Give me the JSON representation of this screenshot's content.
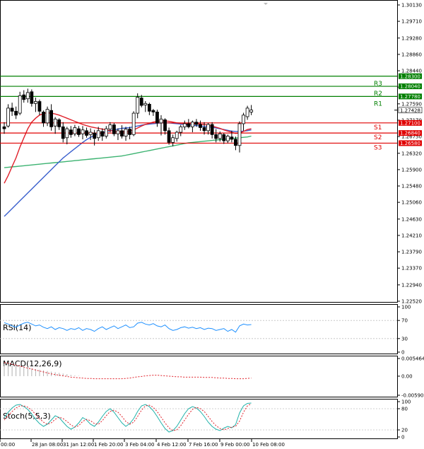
{
  "chart_data": {
    "type": "candlestick",
    "main": {
      "y_ticks": [
        "1.30130",
        "1.29710",
        "1.29280",
        "1.28860",
        "1.28440",
        "1.28020",
        "1.27590",
        "1.27170",
        "1.26750",
        "1.26320",
        "1.25900",
        "1.25480",
        "1.25060",
        "1.24630",
        "1.24210",
        "1.23790",
        "1.23370",
        "1.22940",
        "1.22520"
      ],
      "current_price": "1.27428",
      "levels": [
        {
          "name": "R3",
          "price": "1.28300",
          "color": "#007f00"
        },
        {
          "name": "R2",
          "price": "1.28040",
          "color": "#007f00"
        },
        {
          "name": "R1",
          "price": "1.27780",
          "color": "#007f00"
        },
        {
          "name": "S1",
          "price": "1.27100",
          "color": "#e00000"
        },
        {
          "name": "S2",
          "price": "1.26840",
          "color": "#e00000"
        },
        {
          "name": "S3",
          "price": "1.26580",
          "color": "#e00000"
        }
      ]
    },
    "x_ticks": [
      "00:00",
      "28 Jan 08:00",
      "31 Jan 12:00",
      "1 Feb 20:00",
      "3 Feb 04:00",
      "4 Feb 12:00",
      "7 Feb 16:00",
      "9 Feb 00:00",
      "10 Feb 08:00"
    ],
    "candles": [
      {
        "o": 1.27,
        "h": 1.2712,
        "l": 1.2682,
        "c": 1.2695
      },
      {
        "o": 1.2702,
        "h": 1.2758,
        "l": 1.2698,
        "c": 1.2748
      },
      {
        "o": 1.2748,
        "h": 1.2762,
        "l": 1.2728,
        "c": 1.274
      },
      {
        "o": 1.274,
        "h": 1.2752,
        "l": 1.272,
        "c": 1.273
      },
      {
        "o": 1.2735,
        "h": 1.279,
        "l": 1.273,
        "c": 1.278
      },
      {
        "o": 1.2782,
        "h": 1.2794,
        "l": 1.2762,
        "c": 1.277
      },
      {
        "o": 1.2772,
        "h": 1.2798,
        "l": 1.2762,
        "c": 1.2788
      },
      {
        "o": 1.279,
        "h": 1.2796,
        "l": 1.2752,
        "c": 1.276
      },
      {
        "o": 1.276,
        "h": 1.2775,
        "l": 1.2738,
        "c": 1.2765
      },
      {
        "o": 1.2765,
        "h": 1.277,
        "l": 1.273,
        "c": 1.274
      },
      {
        "o": 1.2738,
        "h": 1.2742,
        "l": 1.27,
        "c": 1.271
      },
      {
        "o": 1.271,
        "h": 1.2752,
        "l": 1.2702,
        "c": 1.2745
      },
      {
        "o": 1.2742,
        "h": 1.2758,
        "l": 1.269,
        "c": 1.27
      },
      {
        "o": 1.2702,
        "h": 1.2725,
        "l": 1.2682,
        "c": 1.272
      },
      {
        "o": 1.2718,
        "h": 1.2722,
        "l": 1.2692,
        "c": 1.27
      },
      {
        "o": 1.27,
        "h": 1.2712,
        "l": 1.266,
        "c": 1.267
      },
      {
        "o": 1.2672,
        "h": 1.27,
        "l": 1.2655,
        "c": 1.2695
      },
      {
        "o": 1.2692,
        "h": 1.2702,
        "l": 1.2672,
        "c": 1.268
      },
      {
        "o": 1.2682,
        "h": 1.2705,
        "l": 1.2676,
        "c": 1.2698
      },
      {
        "o": 1.2695,
        "h": 1.2702,
        "l": 1.2674,
        "c": 1.268
      },
      {
        "o": 1.2682,
        "h": 1.2702,
        "l": 1.2668,
        "c": 1.2692
      },
      {
        "o": 1.269,
        "h": 1.2698,
        "l": 1.2672,
        "c": 1.2678
      },
      {
        "o": 1.268,
        "h": 1.2696,
        "l": 1.2666,
        "c": 1.2686
      },
      {
        "o": 1.2684,
        "h": 1.2692,
        "l": 1.2652,
        "c": 1.267
      },
      {
        "o": 1.2672,
        "h": 1.27,
        "l": 1.2664,
        "c": 1.269
      },
      {
        "o": 1.2688,
        "h": 1.2696,
        "l": 1.2664,
        "c": 1.2676
      },
      {
        "o": 1.2676,
        "h": 1.2702,
        "l": 1.267,
        "c": 1.2695
      },
      {
        "o": 1.2694,
        "h": 1.2712,
        "l": 1.2686,
        "c": 1.2705
      },
      {
        "o": 1.2705,
        "h": 1.271,
        "l": 1.2676,
        "c": 1.2682
      },
      {
        "o": 1.2682,
        "h": 1.2696,
        "l": 1.2666,
        "c": 1.269
      },
      {
        "o": 1.269,
        "h": 1.2704,
        "l": 1.267,
        "c": 1.2676
      },
      {
        "o": 1.2676,
        "h": 1.27,
        "l": 1.2664,
        "c": 1.2694
      },
      {
        "o": 1.2694,
        "h": 1.27,
        "l": 1.2668,
        "c": 1.268
      },
      {
        "o": 1.268,
        "h": 1.274,
        "l": 1.2676,
        "c": 1.2735
      },
      {
        "o": 1.2735,
        "h": 1.2786,
        "l": 1.2722,
        "c": 1.2776
      },
      {
        "o": 1.2774,
        "h": 1.2782,
        "l": 1.275,
        "c": 1.2755
      },
      {
        "o": 1.2756,
        "h": 1.2766,
        "l": 1.2738,
        "c": 1.276
      },
      {
        "o": 1.2758,
        "h": 1.2762,
        "l": 1.273,
        "c": 1.274
      },
      {
        "o": 1.2742,
        "h": 1.2746,
        "l": 1.2728,
        "c": 1.2738
      },
      {
        "o": 1.2738,
        "h": 1.2744,
        "l": 1.27,
        "c": 1.271
      },
      {
        "o": 1.271,
        "h": 1.273,
        "l": 1.2678,
        "c": 1.272
      },
      {
        "o": 1.2718,
        "h": 1.2722,
        "l": 1.268,
        "c": 1.269
      },
      {
        "o": 1.269,
        "h": 1.2698,
        "l": 1.2654,
        "c": 1.266
      },
      {
        "o": 1.266,
        "h": 1.268,
        "l": 1.265,
        "c": 1.2672
      },
      {
        "o": 1.267,
        "h": 1.269,
        "l": 1.2662,
        "c": 1.2686
      },
      {
        "o": 1.2686,
        "h": 1.2705,
        "l": 1.2676,
        "c": 1.27
      },
      {
        "o": 1.27,
        "h": 1.2716,
        "l": 1.2692,
        "c": 1.2708
      },
      {
        "o": 1.2708,
        "h": 1.272,
        "l": 1.2696,
        "c": 1.27
      },
      {
        "o": 1.27,
        "h": 1.2716,
        "l": 1.2686,
        "c": 1.2712
      },
      {
        "o": 1.2712,
        "h": 1.272,
        "l": 1.27,
        "c": 1.2706
      },
      {
        "o": 1.2706,
        "h": 1.2716,
        "l": 1.269,
        "c": 1.2698
      },
      {
        "o": 1.2698,
        "h": 1.2712,
        "l": 1.268,
        "c": 1.269
      },
      {
        "o": 1.269,
        "h": 1.271,
        "l": 1.268,
        "c": 1.2706
      },
      {
        "o": 1.2706,
        "h": 1.2712,
        "l": 1.267,
        "c": 1.268
      },
      {
        "o": 1.268,
        "h": 1.2694,
        "l": 1.266,
        "c": 1.267
      },
      {
        "o": 1.267,
        "h": 1.2688,
        "l": 1.2662,
        "c": 1.2682
      },
      {
        "o": 1.268,
        "h": 1.2684,
        "l": 1.2656,
        "c": 1.2664
      },
      {
        "o": 1.2664,
        "h": 1.268,
        "l": 1.2658,
        "c": 1.2676
      },
      {
        "o": 1.2674,
        "h": 1.269,
        "l": 1.266,
        "c": 1.2668
      },
      {
        "o": 1.2668,
        "h": 1.2675,
        "l": 1.264,
        "c": 1.2652
      },
      {
        "o": 1.2652,
        "h": 1.2714,
        "l": 1.2634,
        "c": 1.2708
      },
      {
        "o": 1.2708,
        "h": 1.2736,
        "l": 1.269,
        "c": 1.273
      },
      {
        "o": 1.2726,
        "h": 1.2754,
        "l": 1.2718,
        "c": 1.2748
      },
      {
        "o": 1.2738,
        "h": 1.2756,
        "l": 1.273,
        "c": 1.2743
      }
    ],
    "ma_fast": [
      1.2555,
      1.2575,
      1.2598,
      1.262,
      1.2648,
      1.2672,
      1.2695,
      1.2712,
      1.2722,
      1.273,
      1.2734,
      1.2736,
      1.2735,
      1.2733,
      1.273,
      1.2726,
      1.2722,
      1.2718,
      1.2714,
      1.271,
      1.2706,
      1.2703,
      1.27,
      1.2698,
      1.2696,
      1.2694,
      1.2692,
      1.269,
      1.2689,
      1.2688,
      1.2688,
      1.2688,
      1.2689,
      1.2692,
      1.2697,
      1.2702,
      1.2706,
      1.2709,
      1.2712,
      1.2714,
      1.2715,
      1.2715,
      1.2714,
      1.2712,
      1.271,
      1.2709,
      1.2708,
      1.2708,
      1.2708,
      1.2708,
      1.2707,
      1.2706,
      1.2704,
      1.2702,
      1.2699,
      1.2696,
      1.2692,
      1.2689,
      1.2686,
      1.2683,
      1.2684,
      1.2688,
      1.2693,
      1.2695
    ],
    "ma_mid": [
      1.247,
      1.248,
      1.249,
      1.25,
      1.251,
      1.252,
      1.253,
      1.254,
      1.255,
      1.256,
      1.257,
      1.258,
      1.259,
      1.26,
      1.261,
      1.262,
      1.2628,
      1.2636,
      1.2644,
      1.2652,
      1.266,
      1.2667,
      1.2673,
      1.2678,
      1.2682,
      1.2685,
      1.2688,
      1.269,
      1.2692,
      1.2694,
      1.2696,
      1.2697,
      1.2698,
      1.27,
      1.2702,
      1.2704,
      1.2706,
      1.2707,
      1.2708,
      1.2709,
      1.271,
      1.271,
      1.271,
      1.2709,
      1.2708,
      1.2707,
      1.2706,
      1.2705,
      1.2704,
      1.2703,
      1.2702,
      1.2701,
      1.27,
      1.2699,
      1.2697,
      1.2695,
      1.2693,
      1.2691,
      1.2689,
      1.2688,
      1.2688,
      1.2689,
      1.269,
      1.2692
    ],
    "ma_slow": [
      1.2595,
      1.2596,
      1.2597,
      1.2598,
      1.2599,
      1.26,
      1.2601,
      1.2602,
      1.2603,
      1.2604,
      1.2605,
      1.2606,
      1.2607,
      1.2608,
      1.2609,
      1.261,
      1.2611,
      1.2612,
      1.2613,
      1.2614,
      1.2615,
      1.2616,
      1.2617,
      1.2618,
      1.2619,
      1.262,
      1.2621,
      1.2622,
      1.2623,
      1.2624,
      1.2625,
      1.2627,
      1.2629,
      1.2631,
      1.2633,
      1.2635,
      1.2637,
      1.2639,
      1.2641,
      1.2643,
      1.2645,
      1.2647,
      1.2649,
      1.2651,
      1.2653,
      1.2655,
      1.2657,
      1.2659,
      1.266,
      1.2661,
      1.2662,
      1.2663,
      1.2664,
      1.2665,
      1.2666,
      1.2667,
      1.2668,
      1.2669,
      1.267,
      1.2671,
      1.2672,
      1.2673,
      1.2674,
      1.2676
    ],
    "rsi": {
      "title": "RSI(14)",
      "ticks": [
        "100",
        "70",
        "30",
        "0"
      ],
      "values": [
        65,
        62,
        58,
        55,
        60,
        64,
        66,
        62,
        58,
        60,
        55,
        52,
        56,
        50,
        54,
        52,
        48,
        52,
        50,
        54,
        48,
        52,
        50,
        46,
        52,
        56,
        50,
        54,
        58,
        52,
        56,
        60,
        54,
        56,
        64,
        66,
        62,
        60,
        63,
        58,
        56,
        60,
        52,
        48,
        50,
        54,
        56,
        53,
        55,
        52,
        54,
        50,
        53,
        52,
        48,
        50,
        52,
        46,
        50,
        44,
        58,
        62,
        60,
        61
      ]
    },
    "macd": {
      "title": "MACD(12,26,9)",
      "ticks": [
        "0.005464",
        "0.00",
        "-0.005908"
      ],
      "hist": [
        0.0038,
        0.0036,
        0.0034,
        0.0032,
        0.003,
        0.0028,
        0.0026,
        0.0024,
        0.0022,
        0.002,
        0.0018,
        0.0016,
        0.0014,
        0.0012,
        0.001,
        0.0008,
        0.0006,
        0.0004,
        0.0002,
        0.0001,
        0,
        0,
        0,
        0,
        0,
        0,
        0,
        0,
        0,
        0,
        0,
        0,
        0,
        0,
        0,
        0,
        0,
        0,
        0,
        0,
        0,
        0,
        0,
        0,
        0,
        0,
        0,
        0,
        0,
        0,
        0,
        0,
        0,
        0,
        0,
        0,
        0,
        0,
        0,
        0,
        0,
        0,
        0,
        0
      ],
      "signal": [
        0.0042,
        0.004,
        0.0037,
        0.0034,
        0.0031,
        0.0028,
        0.0025,
        0.0022,
        0.0019,
        0.0016,
        0.0013,
        0.001,
        0.0007,
        0.0005,
        0.0003,
        0.0001,
        -0.0001,
        -0.0003,
        -0.0004,
        -0.0005,
        -0.0006,
        -0.0007,
        -0.0007,
        -0.0008,
        -0.0008,
        -0.0008,
        -0.0008,
        -0.0008,
        -0.0008,
        -0.0008,
        -0.0008,
        -0.0007,
        -0.0006,
        -0.0004,
        -0.0002,
        -0.0001,
        0.0001,
        0.0002,
        0.0003,
        0.0003,
        0.0002,
        0.0001,
        0.0,
        -0.0001,
        -0.0002,
        -0.0002,
        -0.0003,
        -0.0003,
        -0.0003,
        -0.0003,
        -0.0003,
        -0.0004,
        -0.0004,
        -0.0004,
        -0.0005,
        -0.0006,
        -0.0006,
        -0.0007,
        -0.0007,
        -0.0008,
        -0.0008,
        -0.0008,
        -0.0007,
        -0.0006
      ]
    },
    "stoch": {
      "title": "Stoch(5,5,3)",
      "ticks": [
        "100",
        "80",
        "20",
        "0"
      ],
      "main": [
        55,
        70,
        82,
        90,
        92,
        86,
        78,
        65,
        50,
        38,
        30,
        36,
        48,
        60,
        55,
        42,
        30,
        22,
        28,
        40,
        55,
        48,
        36,
        30,
        42,
        58,
        72,
        80,
        70,
        55,
        40,
        30,
        38,
        52,
        72,
        88,
        92,
        86,
        74,
        58,
        40,
        24,
        14,
        18,
        30,
        48,
        66,
        80,
        86,
        82,
        72,
        58,
        42,
        30,
        22,
        18,
        25,
        30,
        26,
        35,
        68,
        88,
        95,
        96
      ],
      "signal": [
        48,
        60,
        72,
        82,
        88,
        88,
        84,
        76,
        64,
        52,
        42,
        36,
        40,
        50,
        56,
        52,
        44,
        34,
        28,
        32,
        44,
        50,
        46,
        38,
        36,
        46,
        60,
        72,
        76,
        70,
        58,
        44,
        36,
        42,
        58,
        76,
        88,
        90,
        84,
        72,
        56,
        40,
        26,
        18,
        20,
        32,
        48,
        64,
        78,
        84,
        80,
        72,
        58,
        44,
        32,
        24,
        20,
        24,
        28,
        30,
        45,
        70,
        88,
        94
      ]
    }
  }
}
